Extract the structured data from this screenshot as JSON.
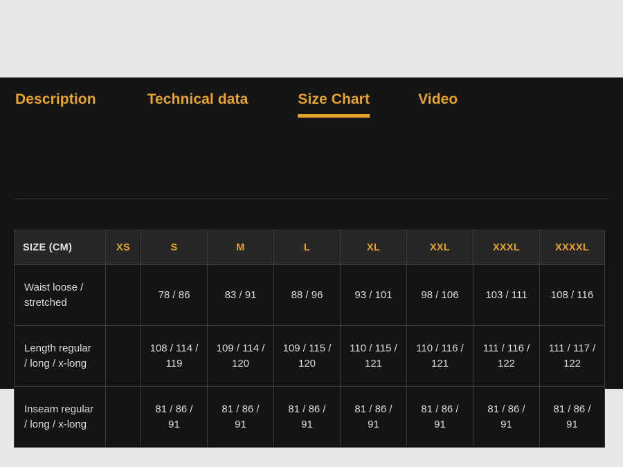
{
  "tabs": [
    {
      "label": "Description",
      "active": false
    },
    {
      "label": "Technical data",
      "active": false
    },
    {
      "label": "Size Chart",
      "active": true
    },
    {
      "label": "Video",
      "active": false
    }
  ],
  "colors": {
    "accent": "#e8a32a",
    "panel_background": "#151515",
    "page_background": "#e7e7e7",
    "header_cell_background": "#272727",
    "body_cell_background": "#141414",
    "grid_border": "#3b3b3b",
    "body_text": "#d8dde1"
  },
  "table": {
    "row_header_label": "SIZE (CM)",
    "columns": [
      "XS",
      "S",
      "M",
      "L",
      "XL",
      "XXL",
      "XXXL",
      "XXXXL"
    ],
    "rows": [
      {
        "label": "Waist loose / stretched",
        "values": [
          "",
          "78 / 86",
          "83 / 91",
          "88 / 96",
          "93 / 101",
          "98 / 106",
          "103 / 111",
          "108 / 116"
        ]
      },
      {
        "label": "Length regular / long / x-long",
        "values": [
          "",
          "108 / 114 / 119",
          "109 / 114 / 120",
          "109 / 115 / 120",
          "110 / 115 / 121",
          "110 / 116 / 121",
          "111 / 116 / 122",
          "111 / 117 / 122"
        ]
      },
      {
        "label": "Inseam regular / long / x-long",
        "values": [
          "",
          "81 / 86 / 91",
          "81 / 86 / 91",
          "81 / 86 / 91",
          "81 / 86 / 91",
          "81 / 86 / 91",
          "81 / 86 / 91",
          "81 / 86 / 91"
        ]
      }
    ]
  }
}
